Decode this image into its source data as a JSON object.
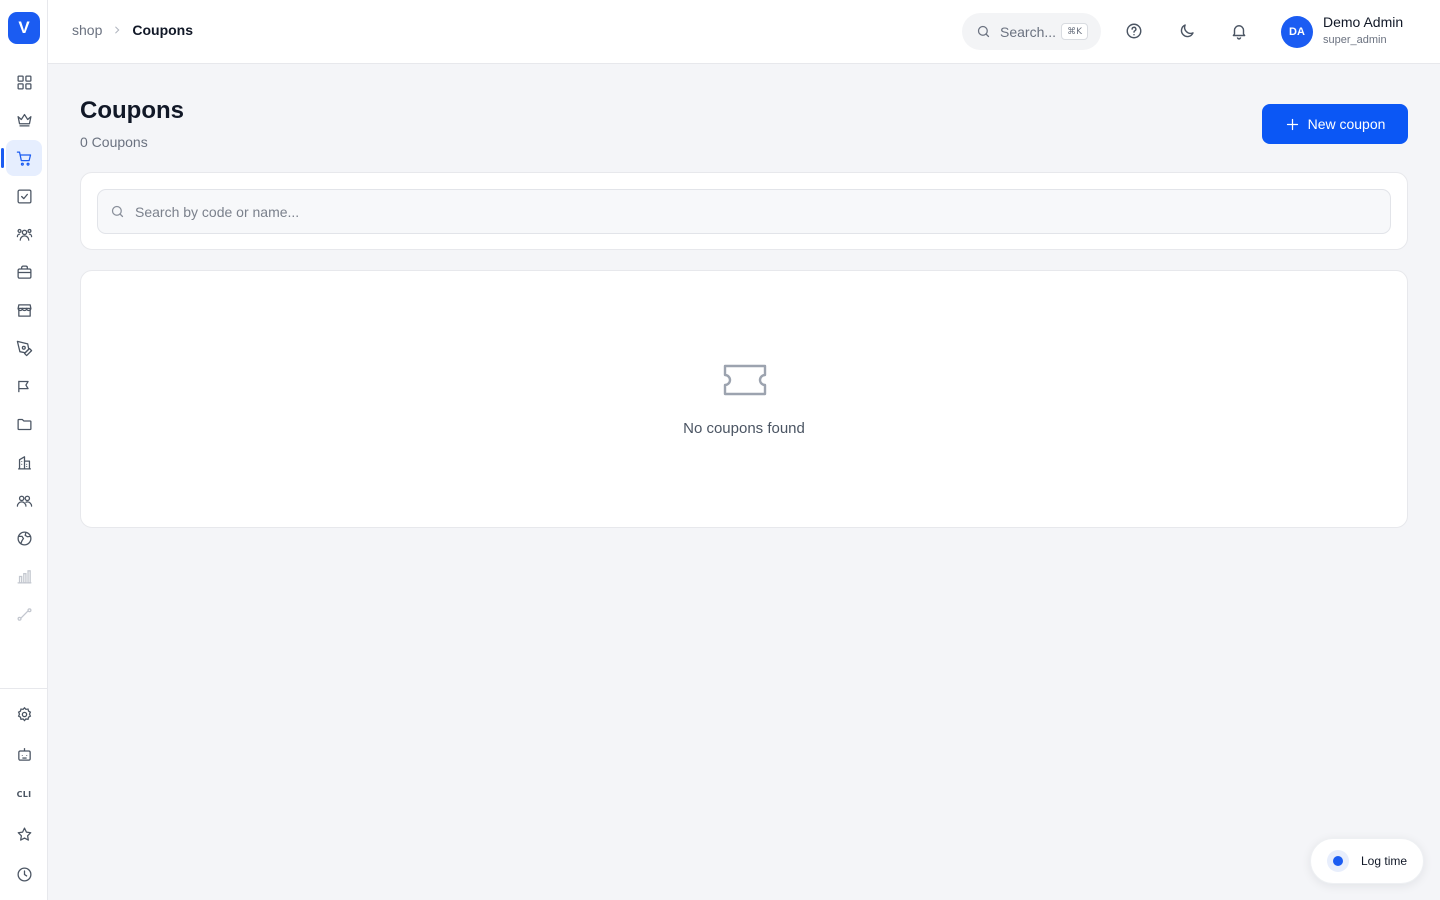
{
  "app": {
    "logo_letter": "V",
    "brand_color": "#1b5cf2"
  },
  "sidebar": {
    "items": [
      {
        "icon": "dashboard-icon",
        "active": false
      },
      {
        "icon": "crown-icon",
        "active": false
      },
      {
        "icon": "shopping-cart-icon",
        "active": true
      },
      {
        "icon": "checkbox-icon",
        "active": false
      },
      {
        "icon": "users-group-icon",
        "active": false
      },
      {
        "icon": "briefcase-icon",
        "active": false
      },
      {
        "icon": "store-icon",
        "active": false
      },
      {
        "icon": "pen-tool-icon",
        "active": false
      },
      {
        "icon": "megaphone-icon",
        "active": false
      },
      {
        "icon": "folder-icon",
        "active": false
      },
      {
        "icon": "building-icon",
        "active": false
      },
      {
        "icon": "team-icon",
        "active": false
      },
      {
        "icon": "globe-icon",
        "active": false
      },
      {
        "icon": "bar-chart-icon",
        "active": false
      },
      {
        "icon": "route-icon",
        "active": false
      }
    ],
    "bottom_items": [
      {
        "icon": "gear-icon"
      },
      {
        "icon": "robot-icon"
      },
      {
        "icon": "cli-icon",
        "label": "CLI"
      },
      {
        "icon": "star-icon"
      },
      {
        "icon": "clock-icon"
      }
    ]
  },
  "header": {
    "breadcrumb": {
      "parent": "shop",
      "current": "Coupons"
    },
    "search": {
      "placeholder": "Search...",
      "shortcut": "⌘K"
    },
    "user": {
      "initials": "DA",
      "name": "Demo Admin",
      "role": "super_admin"
    }
  },
  "main": {
    "title": "Coupons",
    "subtitle": "0 Coupons",
    "new_button_label": "New coupon",
    "filter": {
      "placeholder": "Search by code or name..."
    },
    "empty_state": {
      "icon": "ticket-icon",
      "message": "No coupons found"
    }
  },
  "floating": {
    "log_time_label": "Log time"
  }
}
